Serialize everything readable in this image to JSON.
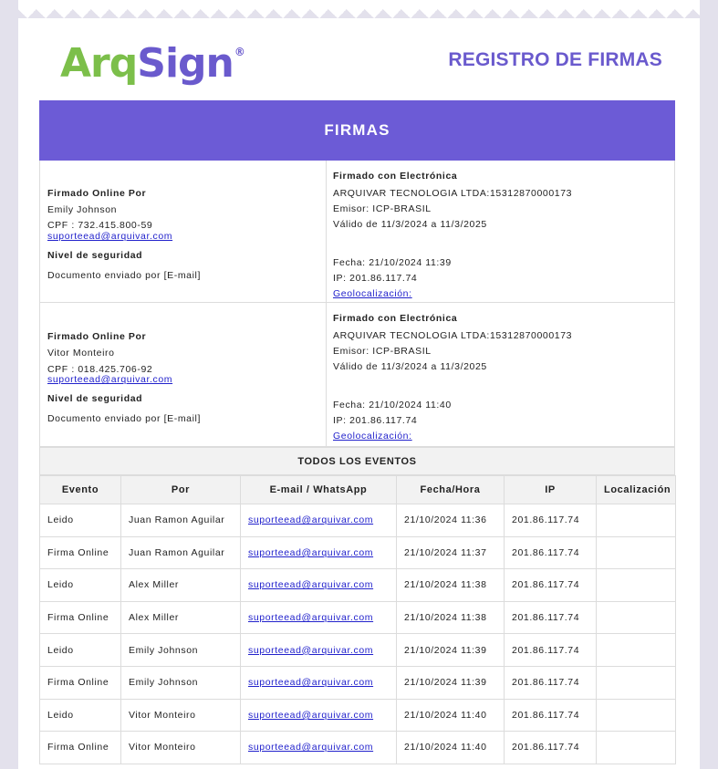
{
  "brand": {
    "logo_part1": "Arq",
    "logo_part2": "Sign",
    "registered": "®"
  },
  "document_title": "REGISTRO DE FIRMAS",
  "banner": "FIRMAS",
  "signatures": [
    {
      "signed_online_label": "Firmado Online Por",
      "name": "Emily Johnson",
      "cpf": "CPF : 732.415.800-59",
      "email": "suporteead@arquivar.com",
      "security_label": "Nivel de seguridad",
      "sent_by": "Documento enviado por [E-mail]",
      "electronic_label": "Firmado con Electrónica",
      "company": "ARQUIVAR TECNOLOGIA LTDA:15312870000173",
      "issuer": "Emisor: ICP-BRASIL",
      "validity": "Válido de 11/3/2024 a 11/3/2025",
      "date": "Fecha: 21/10/2024 11:39",
      "ip": "IP: 201.86.117.74",
      "geo_link": "Geolocalización:"
    },
    {
      "signed_online_label": "Firmado Online Por",
      "name": "Vitor Monteiro",
      "cpf": "CPF : 018.425.706-92",
      "email": "suporteead@arquivar.com",
      "security_label": "Nivel de seguridad",
      "sent_by": "Documento enviado por [E-mail]",
      "electronic_label": "Firmado con Electrónica",
      "company": "ARQUIVAR TECNOLOGIA LTDA:15312870000173",
      "issuer": "Emisor: ICP-BRASIL",
      "validity": "Válido de 11/3/2024 a 11/3/2025",
      "date": "Fecha: 21/10/2024 11:40",
      "ip": "IP: 201.86.117.74",
      "geo_link": "Geolocalización:"
    }
  ],
  "events": {
    "title": "TODOS LOS EVENTOS",
    "headers": [
      "Evento",
      "Por",
      "E-mail / WhatsApp",
      "Fecha/Hora",
      "IP",
      "Localización"
    ],
    "rows": [
      [
        "Leido",
        "Juan Ramon Aguilar",
        "suporteead@arquivar.com",
        "21/10/2024 11:36",
        "201.86.117.74",
        ""
      ],
      [
        "Firma Online",
        "Juan Ramon Aguilar",
        "suporteead@arquivar.com",
        "21/10/2024 11:37",
        "201.86.117.74",
        ""
      ],
      [
        "Leido",
        "Alex Miller",
        "suporteead@arquivar.com",
        "21/10/2024 11:38",
        "201.86.117.74",
        ""
      ],
      [
        "Firma Online",
        "Alex Miller",
        "suporteead@arquivar.com",
        "21/10/2024 11:38",
        "201.86.117.74",
        ""
      ],
      [
        "Leido",
        "Emily Johnson",
        "suporteead@arquivar.com",
        "21/10/2024 11:39",
        "201.86.117.74",
        ""
      ],
      [
        "Firma Online",
        "Emily Johnson",
        "suporteead@arquivar.com",
        "21/10/2024 11:39",
        "201.86.117.74",
        ""
      ],
      [
        "Leido",
        "Vitor Monteiro",
        "suporteead@arquivar.com",
        "21/10/2024 11:40",
        "201.86.117.74",
        ""
      ],
      [
        "Firma Online",
        "Vitor Monteiro",
        "suporteead@arquivar.com",
        "21/10/2024 11:40",
        "201.86.117.74",
        ""
      ]
    ]
  },
  "colors": {
    "brand_purple": "#6c5bd6",
    "brand_green": "#7cbf4a",
    "link": "#2222cc"
  }
}
